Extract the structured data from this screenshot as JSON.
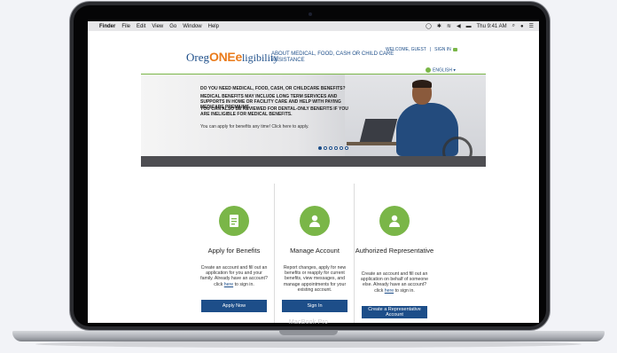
{
  "menubar": {
    "apple": "",
    "items": [
      "Finder",
      "File",
      "Edit",
      "View",
      "Go",
      "Window",
      "Help"
    ],
    "clock": "Thu 9:41 AM"
  },
  "header": {
    "logo_oreg": "Oreg",
    "logo_one": "ONE",
    "logo_elig": "ligibility",
    "tagline": "ABOUT MEDICAL, FOOD, CASH OR CHILD CARE ASSISTANCE",
    "welcome": "WELCOME, GUEST",
    "sign_in": "SIGN IN",
    "language": "ENGLISH"
  },
  "hero": {
    "line1": "DO YOU NEED MEDICAL, FOOD, CASH, OR CHILDCARE BENEFITS?",
    "line2": "MEDICAL BENEFITS MAY INCLUDE LONG TERM SERVICES AND SUPPORTS IN HOME OR FACILITY CARE AND HELP WITH PAYING MEDICARE PREMIUMS.",
    "line3": "YOU CAN ALSO BE REVIEWED FOR DENTAL-ONLY BENEFITS IF YOU ARE INELIGIBLE FOR MEDICAL BENEFITS.",
    "apply_text": "You can apply for benefits any time! Click here to apply.",
    "slide_count": 6,
    "active_slide": 1
  },
  "cards": [
    {
      "title": "Apply for Benefits",
      "desc_pre": "Create an account and fill out an application for you and your family. Already have an account? click ",
      "desc_link": "here",
      "desc_post": " to sign in.",
      "button": "Apply Now"
    },
    {
      "title": "Manage Account",
      "desc": "Report changes, apply for new benefits or reapply for current benefits, view messages, and manage appointments for your existing account.",
      "button": "Sign In"
    },
    {
      "title": "Authorized Representative",
      "desc_pre": "Create an account and fill out an application on behalf of someone else. Already have an account? click ",
      "desc_link": "here",
      "desc_post": " to sign in.",
      "button": "Create a Representative Account"
    }
  ],
  "device": {
    "label": "MacBook Pro"
  },
  "colors": {
    "brand_blue": "#1d4e89",
    "brand_orange": "#ea7b1b",
    "brand_green": "#7ab648"
  }
}
